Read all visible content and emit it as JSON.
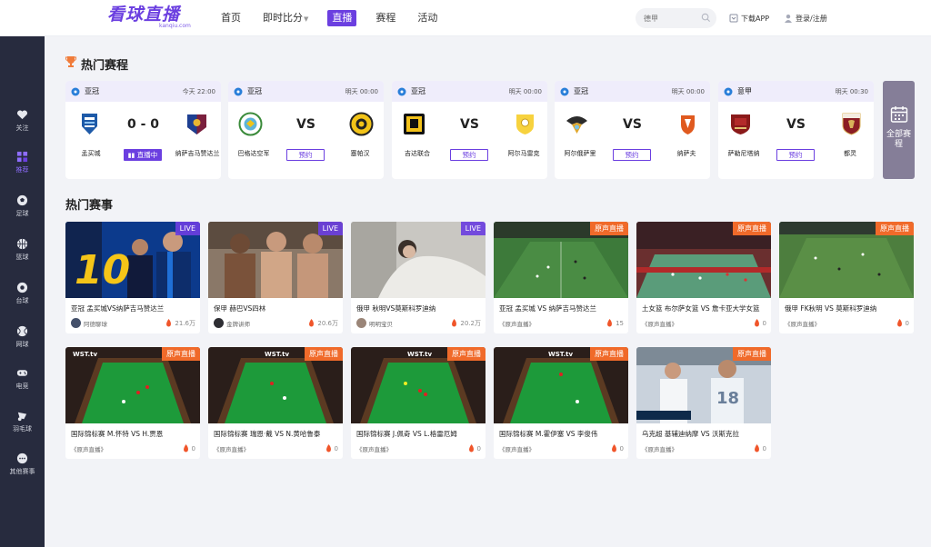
{
  "header": {
    "logo_text": "看球直播",
    "logo_sub": "kanqiu.com",
    "nav": [
      "首页",
      "即时比分",
      "直播",
      "赛程",
      "活动"
    ],
    "search_placeholder": "德甲",
    "download_label": "下载APP",
    "login_label": "登录/注册"
  },
  "sidebar": {
    "items": [
      {
        "label": "关注",
        "icon": "heart-icon"
      },
      {
        "label": "推荐",
        "icon": "recommend-icon"
      },
      {
        "label": "足球",
        "icon": "football-icon"
      },
      {
        "label": "篮球",
        "icon": "basketball-icon"
      },
      {
        "label": "台球",
        "icon": "billiards-icon"
      },
      {
        "label": "网球",
        "icon": "tennis-icon"
      },
      {
        "label": "电竞",
        "icon": "gamepad-icon"
      },
      {
        "label": "羽毛球",
        "icon": "shuttlecock-icon"
      },
      {
        "label": "其他赛事",
        "icon": "more-icon"
      }
    ]
  },
  "hot_matches": {
    "title": "热门赛程",
    "matches": [
      {
        "league": "亚冠",
        "time": "今天 22:00",
        "home": "孟买城",
        "away": "纳萨吉马赞达兰",
        "score": "0 - 0",
        "status": "直播中"
      },
      {
        "league": "亚冠",
        "time": "明天 00:00",
        "home": "巴格达空军",
        "away": "塞帕汉",
        "score": "VS",
        "status": "预约"
      },
      {
        "league": "亚冠",
        "time": "明天 00:00",
        "home": "吉达联合",
        "away": "阿尔马雷克",
        "score": "VS",
        "status": "预约"
      },
      {
        "league": "亚冠",
        "time": "明天 00:00",
        "home": "阿尔俄萨里",
        "away": "纳萨夫",
        "score": "VS",
        "status": "预约"
      },
      {
        "league": "意甲",
        "time": "明天 00:30",
        "home": "萨勒尼塔纳",
        "away": "都灵",
        "score": "VS",
        "status": "预约"
      }
    ],
    "all_label": "全部赛程"
  },
  "hot_events": {
    "title": "热门赛事",
    "items": [
      {
        "title": "亚冠 孟买城VS纳萨吉马赞达兰",
        "anchor": "阿德聊球",
        "heat": "21.6万",
        "badge": "LIVE"
      },
      {
        "title": "保甲 赫巴VS四林",
        "anchor": "金牌讲师",
        "heat": "20.6万",
        "badge": "LIVE"
      },
      {
        "title": "俄甲 秋明VS莫斯科罗迪纳",
        "anchor": "明明宝贝",
        "heat": "20.2万",
        "badge": "LIVE"
      },
      {
        "title": "亚冠 孟买城 VS 纳萨吉马赞达兰",
        "anchor": "《原声直播》",
        "heat": "15",
        "badge": "原声直播"
      },
      {
        "title": "土女篮 布尔萨女篮 VS 詹卡亚大学女篮",
        "anchor": "《原声直播》",
        "heat": "0",
        "badge": "原声直播"
      },
      {
        "title": "俄甲 FK秋明 VS 莫斯科罗迪纳",
        "anchor": "《原声直播》",
        "heat": "0",
        "badge": "原声直播"
      },
      {
        "title": "国际锦标赛 M.怀特 VS H.贾恩",
        "anchor": "《原声直播》",
        "heat": "0",
        "badge": "原声直播"
      },
      {
        "title": "国际锦标赛 瑞恩·戴 VS N.黄哈鲁泰",
        "anchor": "《原声直播》",
        "heat": "0",
        "badge": "原声直播"
      },
      {
        "title": "国际锦标赛 J.佩奇 VS L.格雷厄姆",
        "anchor": "《原声直播》",
        "heat": "0",
        "badge": "原声直播"
      },
      {
        "title": "国际锦标赛 M.霍伊塞 VS 李俊伟",
        "anchor": "《原声直播》",
        "heat": "0",
        "badge": "原声直播"
      },
      {
        "title": "乌克超 基辅迪纳摩 VS 沃斯克拉",
        "anchor": "《原声直播》",
        "heat": "0",
        "badge": "原声直播"
      }
    ],
    "thumb_texts": {
      "jersey_number": "10",
      "wst": "WST.tv"
    }
  },
  "colors": {
    "accent": "#6b3fe0",
    "sidebar_bg": "#272b3e",
    "orange": "#f06a2a",
    "page_bg": "#f2f3f7"
  }
}
